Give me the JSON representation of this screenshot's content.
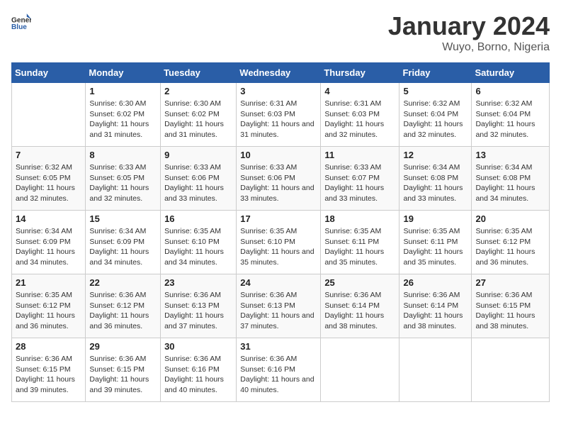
{
  "logo": {
    "general": "General",
    "blue": "Blue"
  },
  "title": "January 2024",
  "subtitle": "Wuyo, Borno, Nigeria",
  "headers": [
    "Sunday",
    "Monday",
    "Tuesday",
    "Wednesday",
    "Thursday",
    "Friday",
    "Saturday"
  ],
  "weeks": [
    [
      {
        "day": "",
        "sunrise": "",
        "sunset": "",
        "daylight": ""
      },
      {
        "day": "1",
        "sunrise": "Sunrise: 6:30 AM",
        "sunset": "Sunset: 6:02 PM",
        "daylight": "Daylight: 11 hours and 31 minutes."
      },
      {
        "day": "2",
        "sunrise": "Sunrise: 6:30 AM",
        "sunset": "Sunset: 6:02 PM",
        "daylight": "Daylight: 11 hours and 31 minutes."
      },
      {
        "day": "3",
        "sunrise": "Sunrise: 6:31 AM",
        "sunset": "Sunset: 6:03 PM",
        "daylight": "Daylight: 11 hours and 31 minutes."
      },
      {
        "day": "4",
        "sunrise": "Sunrise: 6:31 AM",
        "sunset": "Sunset: 6:03 PM",
        "daylight": "Daylight: 11 hours and 32 minutes."
      },
      {
        "day": "5",
        "sunrise": "Sunrise: 6:32 AM",
        "sunset": "Sunset: 6:04 PM",
        "daylight": "Daylight: 11 hours and 32 minutes."
      },
      {
        "day": "6",
        "sunrise": "Sunrise: 6:32 AM",
        "sunset": "Sunset: 6:04 PM",
        "daylight": "Daylight: 11 hours and 32 minutes."
      }
    ],
    [
      {
        "day": "7",
        "sunrise": "Sunrise: 6:32 AM",
        "sunset": "Sunset: 6:05 PM",
        "daylight": "Daylight: 11 hours and 32 minutes."
      },
      {
        "day": "8",
        "sunrise": "Sunrise: 6:33 AM",
        "sunset": "Sunset: 6:05 PM",
        "daylight": "Daylight: 11 hours and 32 minutes."
      },
      {
        "day": "9",
        "sunrise": "Sunrise: 6:33 AM",
        "sunset": "Sunset: 6:06 PM",
        "daylight": "Daylight: 11 hours and 33 minutes."
      },
      {
        "day": "10",
        "sunrise": "Sunrise: 6:33 AM",
        "sunset": "Sunset: 6:06 PM",
        "daylight": "Daylight: 11 hours and 33 minutes."
      },
      {
        "day": "11",
        "sunrise": "Sunrise: 6:33 AM",
        "sunset": "Sunset: 6:07 PM",
        "daylight": "Daylight: 11 hours and 33 minutes."
      },
      {
        "day": "12",
        "sunrise": "Sunrise: 6:34 AM",
        "sunset": "Sunset: 6:08 PM",
        "daylight": "Daylight: 11 hours and 33 minutes."
      },
      {
        "day": "13",
        "sunrise": "Sunrise: 6:34 AM",
        "sunset": "Sunset: 6:08 PM",
        "daylight": "Daylight: 11 hours and 34 minutes."
      }
    ],
    [
      {
        "day": "14",
        "sunrise": "Sunrise: 6:34 AM",
        "sunset": "Sunset: 6:09 PM",
        "daylight": "Daylight: 11 hours and 34 minutes."
      },
      {
        "day": "15",
        "sunrise": "Sunrise: 6:34 AM",
        "sunset": "Sunset: 6:09 PM",
        "daylight": "Daylight: 11 hours and 34 minutes."
      },
      {
        "day": "16",
        "sunrise": "Sunrise: 6:35 AM",
        "sunset": "Sunset: 6:10 PM",
        "daylight": "Daylight: 11 hours and 34 minutes."
      },
      {
        "day": "17",
        "sunrise": "Sunrise: 6:35 AM",
        "sunset": "Sunset: 6:10 PM",
        "daylight": "Daylight: 11 hours and 35 minutes."
      },
      {
        "day": "18",
        "sunrise": "Sunrise: 6:35 AM",
        "sunset": "Sunset: 6:11 PM",
        "daylight": "Daylight: 11 hours and 35 minutes."
      },
      {
        "day": "19",
        "sunrise": "Sunrise: 6:35 AM",
        "sunset": "Sunset: 6:11 PM",
        "daylight": "Daylight: 11 hours and 35 minutes."
      },
      {
        "day": "20",
        "sunrise": "Sunrise: 6:35 AM",
        "sunset": "Sunset: 6:12 PM",
        "daylight": "Daylight: 11 hours and 36 minutes."
      }
    ],
    [
      {
        "day": "21",
        "sunrise": "Sunrise: 6:35 AM",
        "sunset": "Sunset: 6:12 PM",
        "daylight": "Daylight: 11 hours and 36 minutes."
      },
      {
        "day": "22",
        "sunrise": "Sunrise: 6:36 AM",
        "sunset": "Sunset: 6:12 PM",
        "daylight": "Daylight: 11 hours and 36 minutes."
      },
      {
        "day": "23",
        "sunrise": "Sunrise: 6:36 AM",
        "sunset": "Sunset: 6:13 PM",
        "daylight": "Daylight: 11 hours and 37 minutes."
      },
      {
        "day": "24",
        "sunrise": "Sunrise: 6:36 AM",
        "sunset": "Sunset: 6:13 PM",
        "daylight": "Daylight: 11 hours and 37 minutes."
      },
      {
        "day": "25",
        "sunrise": "Sunrise: 6:36 AM",
        "sunset": "Sunset: 6:14 PM",
        "daylight": "Daylight: 11 hours and 38 minutes."
      },
      {
        "day": "26",
        "sunrise": "Sunrise: 6:36 AM",
        "sunset": "Sunset: 6:14 PM",
        "daylight": "Daylight: 11 hours and 38 minutes."
      },
      {
        "day": "27",
        "sunrise": "Sunrise: 6:36 AM",
        "sunset": "Sunset: 6:15 PM",
        "daylight": "Daylight: 11 hours and 38 minutes."
      }
    ],
    [
      {
        "day": "28",
        "sunrise": "Sunrise: 6:36 AM",
        "sunset": "Sunset: 6:15 PM",
        "daylight": "Daylight: 11 hours and 39 minutes."
      },
      {
        "day": "29",
        "sunrise": "Sunrise: 6:36 AM",
        "sunset": "Sunset: 6:15 PM",
        "daylight": "Daylight: 11 hours and 39 minutes."
      },
      {
        "day": "30",
        "sunrise": "Sunrise: 6:36 AM",
        "sunset": "Sunset: 6:16 PM",
        "daylight": "Daylight: 11 hours and 40 minutes."
      },
      {
        "day": "31",
        "sunrise": "Sunrise: 6:36 AM",
        "sunset": "Sunset: 6:16 PM",
        "daylight": "Daylight: 11 hours and 40 minutes."
      },
      {
        "day": "",
        "sunrise": "",
        "sunset": "",
        "daylight": ""
      },
      {
        "day": "",
        "sunrise": "",
        "sunset": "",
        "daylight": ""
      },
      {
        "day": "",
        "sunrise": "",
        "sunset": "",
        "daylight": ""
      }
    ]
  ]
}
